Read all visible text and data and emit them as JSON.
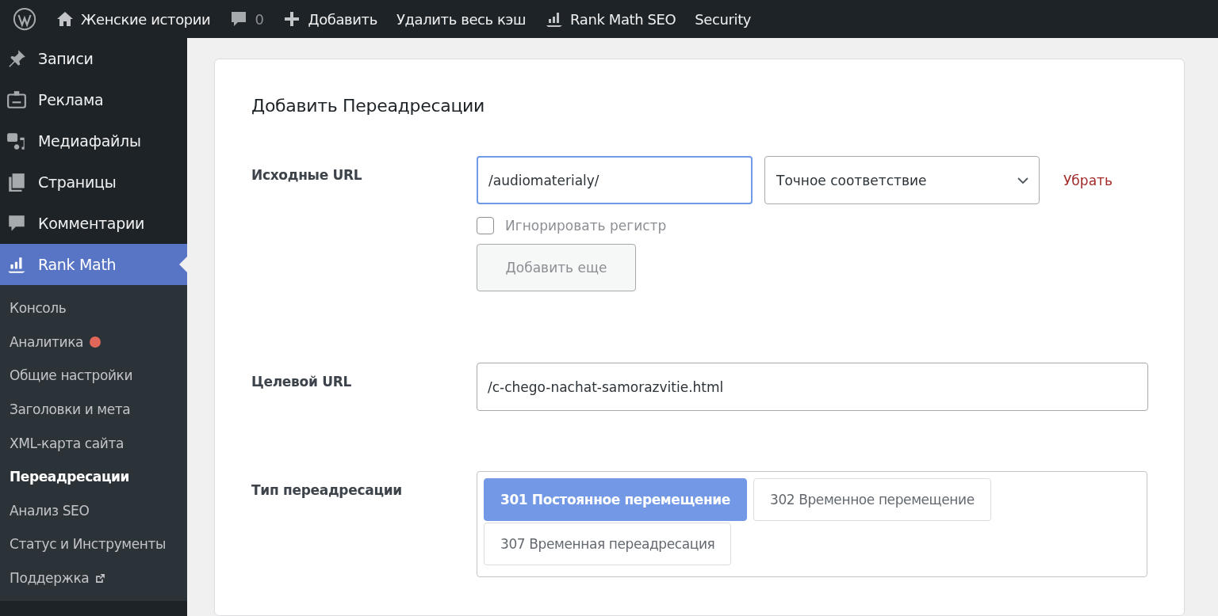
{
  "admin_bar": {
    "items": [
      {
        "kind": "logo"
      },
      {
        "kind": "home",
        "label": "Женские истории"
      },
      {
        "kind": "comments",
        "label": "0"
      },
      {
        "kind": "new",
        "label": "Добавить"
      },
      {
        "kind": "text",
        "label": "Удалить весь кэш"
      },
      {
        "kind": "rankmath",
        "label": "Rank Math SEO"
      },
      {
        "kind": "text",
        "label": "Security"
      }
    ]
  },
  "sidebar": {
    "items": [
      {
        "kind": "pin",
        "label": "Записи",
        "selected": false
      },
      {
        "kind": "ad",
        "label": "Реклама",
        "selected": false
      },
      {
        "kind": "media",
        "label": "Медиафайлы",
        "selected": false
      },
      {
        "kind": "pages",
        "label": "Страницы",
        "selected": false
      },
      {
        "kind": "comment",
        "label": "Комментарии",
        "selected": false
      },
      {
        "kind": "rankmath",
        "label": "Rank Math",
        "selected": true
      }
    ],
    "submenu": [
      {
        "label": "Консоль",
        "selected": false
      },
      {
        "label": "Аналитика",
        "selected": false,
        "color": "#e2675b"
      },
      {
        "label": "Общие настройки",
        "selected": false
      },
      {
        "label": "Заголовки и мета",
        "selected": false
      },
      {
        "label": "XML-карта сайта",
        "selected": false
      },
      {
        "label": "Переадресации",
        "selected": true
      },
      {
        "label": "Анализ SEO",
        "selected": false
      },
      {
        "label": "Статус и Инструменты",
        "selected": false
      },
      {
        "label": "Поддержка",
        "selected": false,
        "external": true
      }
    ]
  },
  "form": {
    "title": "Добавить Переадресации",
    "source": {
      "label": "Исходные URL",
      "value": "/audiomaterialy/",
      "focused": true,
      "match": "Точное соответствие",
      "remove": "Убрать",
      "ignore_case": {
        "label": "Игнорировать регистр",
        "checked": false
      },
      "add_more": "Добавить еще"
    },
    "target": {
      "label": "Целевой URL",
      "value": "/c-chego-nachat-samorazvitie.html"
    },
    "type": {
      "label": "Тип переадресации",
      "options": [
        {
          "label": "301 Постоянное перемещение",
          "selected": true
        },
        {
          "label": "302 Временное перемещение",
          "selected": false
        },
        {
          "label": "307 Временная переадресация",
          "selected": false
        }
      ]
    }
  }
}
